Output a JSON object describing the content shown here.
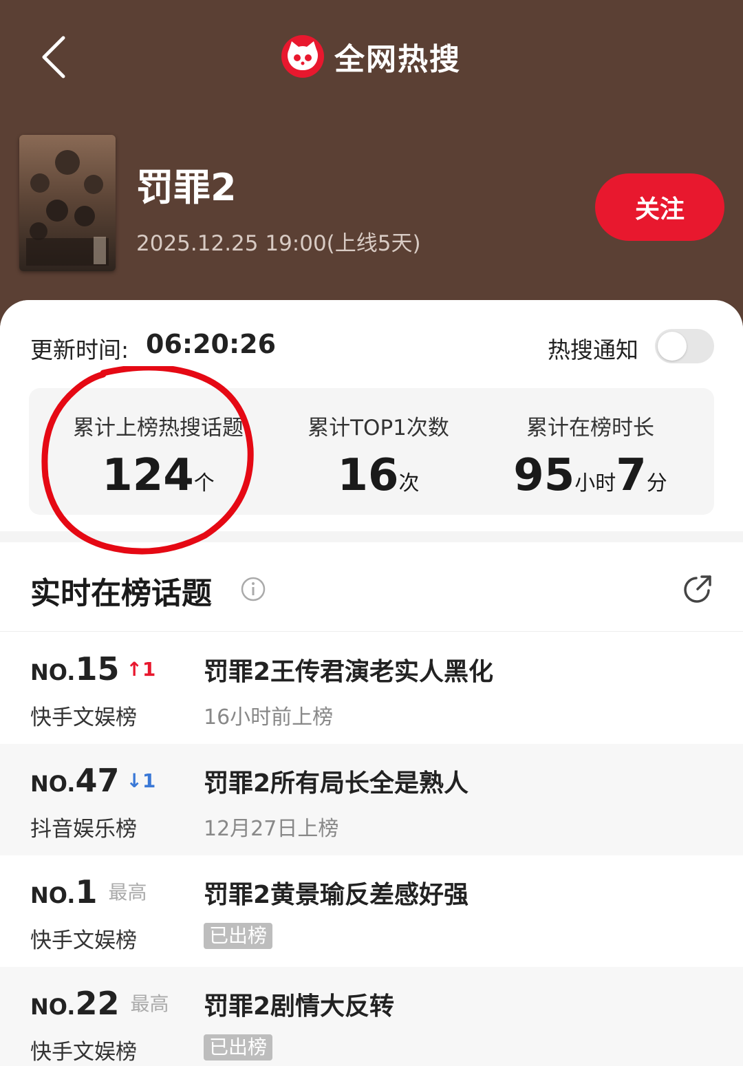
{
  "header": {
    "back_icon": "chevron-left-icon",
    "brand_icon": "cat-logo-icon",
    "brand_title": "全网热搜"
  },
  "show": {
    "title": "罚罪2",
    "date": "2025.12.25 19:00(上线5天)",
    "follow_label": "关注"
  },
  "update": {
    "label": "更新时间:",
    "time": "06:20:26",
    "notify_label": "热搜通知",
    "notify_on": false
  },
  "stats": [
    {
      "label": "累计上榜热搜话题",
      "value": "124",
      "unit": "个"
    },
    {
      "label": "累计TOP1次数",
      "value": "16",
      "unit": "次"
    },
    {
      "label": "累计在榜时长",
      "value1": "95",
      "unit1": "小时",
      "value2": "7",
      "unit2": "分"
    }
  ],
  "section": {
    "title": "实时在榜话题",
    "info_icon": "info-icon",
    "share_icon": "share-icon"
  },
  "rows": [
    {
      "no_prefix": "NO.",
      "rank": "15",
      "trend": "↑1",
      "trend_type": "up",
      "board": "快手文娱榜",
      "topic": "罚罪2王传君演老实人黑化",
      "meta": "16小时前上榜"
    },
    {
      "no_prefix": "NO.",
      "rank": "47",
      "trend": "↓1",
      "trend_type": "down",
      "board": "抖音娱乐榜",
      "topic": "罚罪2所有局长全是熟人",
      "meta": "12月27日上榜"
    },
    {
      "no_prefix": "NO.",
      "rank": "1",
      "trend": "最高",
      "trend_type": "best",
      "board": "快手文娱榜",
      "topic": "罚罪2黄景瑜反差感好强",
      "badge": "已出榜"
    },
    {
      "no_prefix": "NO.",
      "rank": "22",
      "trend": "最高",
      "trend_type": "best",
      "board": "快手文娱榜",
      "topic": "罚罪2剧情大反转",
      "badge": "已出榜"
    }
  ],
  "colors": {
    "header_bg": "#5b4034",
    "accent_red": "#e8182e",
    "trend_down": "#3a78d6",
    "badge_gray": "#bdbdbd"
  }
}
